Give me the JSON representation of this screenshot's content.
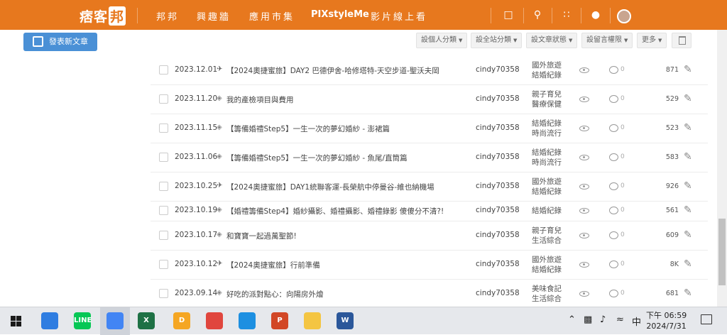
{
  "brand": {
    "logo_text": "痞客",
    "logo_box": "邦"
  },
  "nav": {
    "links": [
      "邦邦",
      "興趣牆",
      "應用市集",
      "PIXstyleMe",
      "影片線上看"
    ],
    "icons": [
      "bookmark-icon",
      "search-icon",
      "apps-grid-icon",
      "bell-icon",
      "avatar"
    ]
  },
  "toolbar": {
    "new_post": "發表新文章",
    "dropdowns": [
      "設個人分類",
      "設全站分類",
      "設文章狀態",
      "設留言權限",
      "更多"
    ]
  },
  "articles": [
    {
      "date": "2023.12.01",
      "status": "✈",
      "title": "【2024奧捷蜜旅】DAY2 巴德伊舍-哈修塔特-天空步道-聖沃夫岡",
      "author": "cindy70358",
      "cat1": "國外旅遊",
      "cat2": "結婚紀錄",
      "comments": "0",
      "views": "871"
    },
    {
      "date": "2023.11.20",
      "status": "◈",
      "title": "我的產檢項目與費用",
      "author": "cindy70358",
      "cat1": "親子育兒",
      "cat2": "醫療保健",
      "comments": "0",
      "views": "529"
    },
    {
      "date": "2023.11.15",
      "status": "◈",
      "title": "【籌備婚禮Step5】一生一次的夢幻婚紗 - 澎裙篇",
      "author": "cindy70358",
      "cat1": "結婚紀錄",
      "cat2": "時尚流行",
      "comments": "0",
      "views": "523"
    },
    {
      "date": "2023.11.06",
      "status": "◈",
      "title": "【籌備婚禮Step5】一生一次的夢幻婚紗 - 魚尾/直筒篇",
      "author": "cindy70358",
      "cat1": "結婚紀錄",
      "cat2": "時尚流行",
      "comments": "0",
      "views": "583"
    },
    {
      "date": "2023.10.25",
      "status": "✈",
      "title": "【2024奧捷蜜旅】DAY1統聯客運-長榮航中停曼谷-維也納機場",
      "author": "cindy70358",
      "cat1": "國外旅遊",
      "cat2": "結婚紀錄",
      "comments": "0",
      "views": "926"
    },
    {
      "date": "2023.10.19",
      "status": "◈",
      "title": "【婚禮籌備Step4】婚紗攝影、婚禮攝影、婚禮錄影 傻傻分不清?!",
      "author": "cindy70358",
      "cat1": "結婚紀錄",
      "cat2": "",
      "comments": "0",
      "views": "561"
    },
    {
      "date": "2023.10.17",
      "status": "◈",
      "title": "和寶寶一起過萬聖節!",
      "author": "cindy70358",
      "cat1": "親子育兒",
      "cat2": "生活綜合",
      "comments": "0",
      "views": "609"
    },
    {
      "date": "2023.10.12",
      "status": "✈",
      "title": "【2024奧捷蜜旅】行前準備",
      "author": "cindy70358",
      "cat1": "國外旅遊",
      "cat2": "結婚紀錄",
      "comments": "0",
      "views": "8K"
    },
    {
      "date": "2023.09.14",
      "status": "◈",
      "title": "好吃的派對點心：向陽房外燴",
      "author": "cindy70358",
      "cat1": "美味食記",
      "cat2": "生活綜合",
      "comments": "0",
      "views": "681"
    }
  ],
  "taskbar": {
    "apps": [
      {
        "name": "mail-app-icon",
        "color": "#2f7de1",
        "label": ""
      },
      {
        "name": "line-app-icon",
        "color": "#06c755",
        "label": "LINE"
      },
      {
        "name": "chrome-app-icon",
        "color": "#4285f4",
        "label": ""
      },
      {
        "name": "excel-app-icon",
        "color": "#1e7145",
        "label": "X"
      },
      {
        "name": "dict-app-icon",
        "color": "#f5a623",
        "label": "D"
      },
      {
        "name": "app-red-icon",
        "color": "#e0463e",
        "label": ""
      },
      {
        "name": "edge-app-icon",
        "color": "#1d8fe1",
        "label": ""
      },
      {
        "name": "powerpoint-app-icon",
        "color": "#d24726",
        "label": "P"
      },
      {
        "name": "explorer-app-icon",
        "color": "#f4c542",
        "label": ""
      },
      {
        "name": "word-app-icon",
        "color": "#2b579a",
        "label": "W"
      }
    ],
    "ime": "中",
    "time": "下午 06:59",
    "date": "2024/7/31"
  },
  "colors": {
    "brand": "#e7781e",
    "primary_button": "#4a90d6"
  }
}
